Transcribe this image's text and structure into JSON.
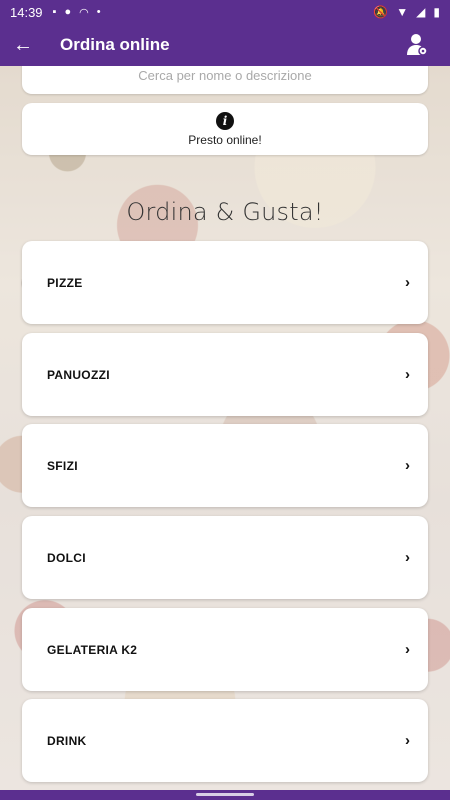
{
  "statusbar": {
    "time": "14:39",
    "left_icons": [
      "small-app-icon",
      "circle-icon",
      "cast-icon",
      "dot-icon"
    ],
    "right_icons": [
      "dnd-off-icon",
      "wifi-icon",
      "signal-icon",
      "battery-icon"
    ]
  },
  "appbar": {
    "title": "Ordina online",
    "back_icon": "arrow-back-icon",
    "user_icon": "user-settings-icon"
  },
  "search": {
    "placeholder": "Cerca per nome o descrizione"
  },
  "notice": {
    "icon": "info-icon",
    "text": "Presto online!"
  },
  "headline": "Ordina & Gusta!",
  "categories": [
    {
      "label": "PIZZE"
    },
    {
      "label": "PANUOZZI"
    },
    {
      "label": "SFIZI"
    },
    {
      "label": "DOLCI"
    },
    {
      "label": "GELATERIA K2"
    },
    {
      "label": "DRINK"
    }
  ],
  "colors": {
    "primary": "#5b2f8f",
    "card": "#ffffff",
    "text": "#111111"
  }
}
